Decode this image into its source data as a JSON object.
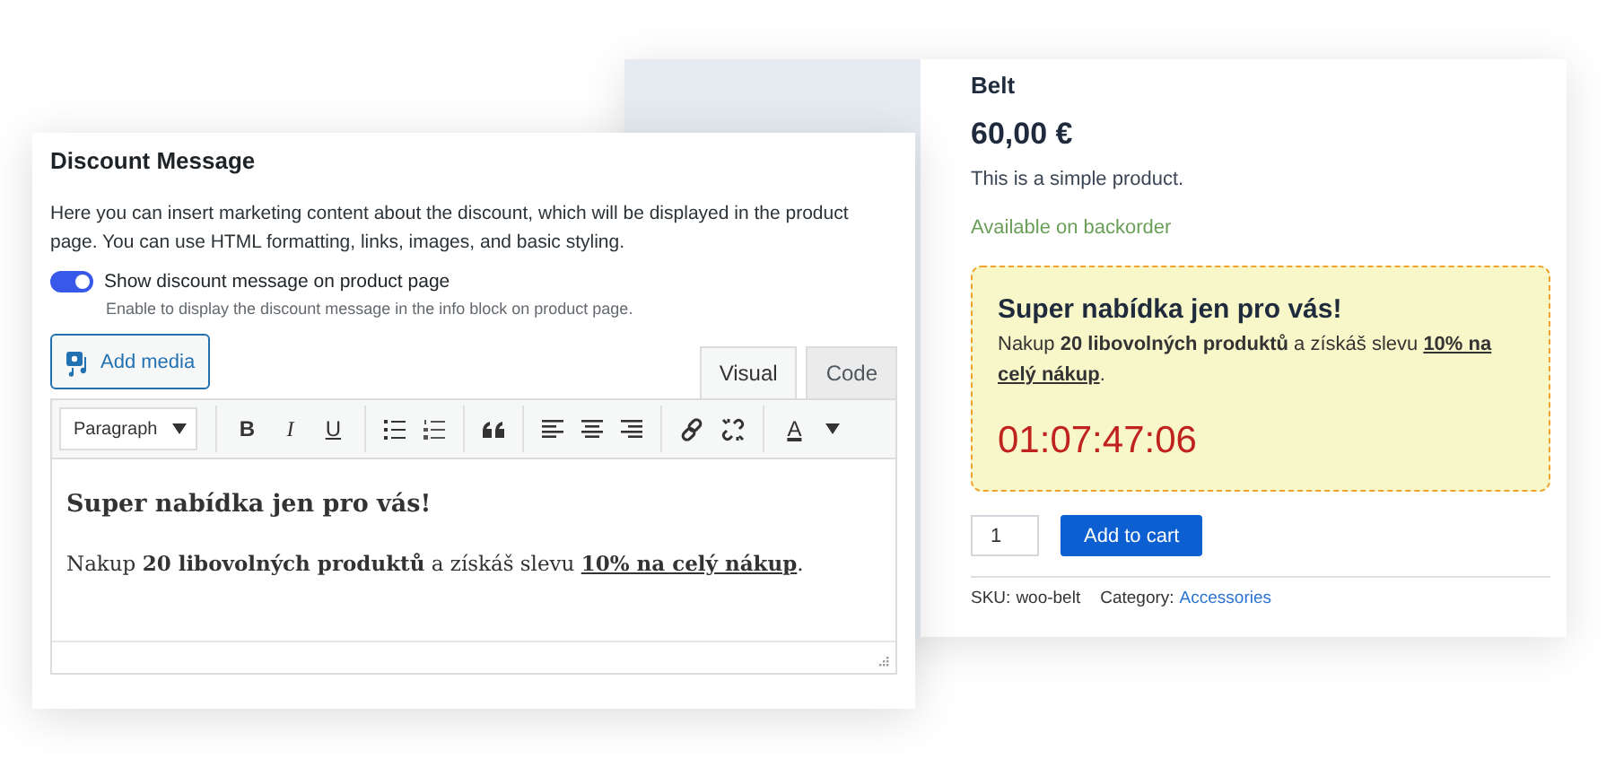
{
  "product": {
    "name": "Belt",
    "price": "60,00 €",
    "description": "This is a simple product.",
    "stock": "Available on backorder",
    "discount_box": {
      "title": "Super nabídka jen pro vás!",
      "message": [
        {
          "text": "Nakup ",
          "bold": false,
          "underline": false
        },
        {
          "text": "20 libovolných produktů",
          "bold": true,
          "underline": false
        },
        {
          "text": " a získáš slevu ",
          "bold": false,
          "underline": false
        },
        {
          "text": "10% na celý nákup",
          "bold": true,
          "underline": true
        },
        {
          "text": ".",
          "bold": false,
          "underline": false
        }
      ],
      "countdown": "01:07:47:06"
    },
    "quantity": "1",
    "add_button": "Add to cart",
    "sku_label": "SKU:",
    "sku": "woo-belt",
    "category_label": "Category:",
    "category": "Accessories"
  },
  "settings": {
    "title": "Discount Message",
    "description": "Here you can insert marketing content about the discount, which will be displayed in the product page. You can use HTML formatting, links, images, and basic styling.",
    "toggle": {
      "label": "Show discount message on product page",
      "on": true,
      "hint": "Enable to display the discount message in the info block on product page."
    },
    "add_media": "Add media",
    "tabs": [
      {
        "label": "Visual",
        "selected": true
      },
      {
        "label": "Code",
        "selected": false
      }
    ],
    "format": "Paragraph",
    "toolbar": [
      {
        "kind": "bold",
        "label": "B"
      },
      {
        "kind": "italic",
        "label": "I"
      },
      {
        "kind": "underline",
        "label": "U"
      },
      {
        "kind": "bullets"
      },
      {
        "kind": "numbers"
      },
      {
        "kind": "quote"
      },
      {
        "kind": "align-left"
      },
      {
        "kind": "align-center"
      },
      {
        "kind": "align-right"
      },
      {
        "kind": "link"
      },
      {
        "kind": "unlink"
      },
      {
        "kind": "color",
        "label": "A"
      }
    ],
    "content": {
      "heading": "Super nabídka jen pro vás!",
      "paragraph": [
        {
          "text": "Nakup ",
          "bold": false,
          "underline": false
        },
        {
          "text": "20 libovolných produktů",
          "bold": true,
          "underline": false
        },
        {
          "text": " a získáš slevu ",
          "bold": false,
          "underline": false
        },
        {
          "text": "10% na celý nákup",
          "bold": true,
          "underline": true
        },
        {
          "text": ".",
          "bold": false,
          "underline": false
        }
      ]
    }
  }
}
